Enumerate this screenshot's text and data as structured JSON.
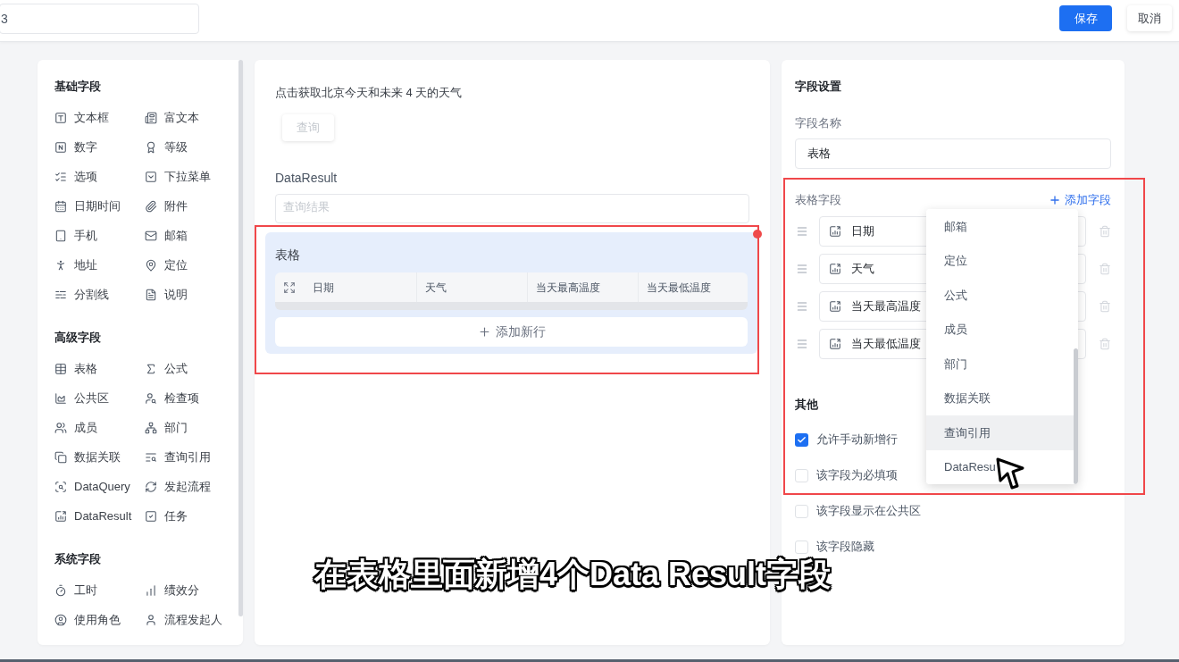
{
  "top_bar": {
    "name_field": {
      "value": "3"
    },
    "buttons": [
      {
        "label": "保存",
        "kind": "primary"
      },
      {
        "label": "取消",
        "kind": "secondary"
      }
    ]
  },
  "field_palette": {
    "sections": [
      {
        "title": "基础字段",
        "items": [
          "文本框",
          "富文本",
          "数字",
          "等级",
          "选项",
          "下拉菜单",
          "日期时间",
          "附件",
          "手机",
          "邮箱",
          "地址",
          "定位",
          "分割线",
          "说明"
        ]
      },
      {
        "title": "高级字段",
        "items": [
          "表格",
          "公式",
          "公共区",
          "检查项",
          "成员",
          "部门",
          "数据关联",
          "查询引用",
          "DataQuery",
          "发起流程",
          "DataResult",
          "任务"
        ]
      },
      {
        "title": "系统字段",
        "items": [
          "工时",
          "绩效分",
          "使用角色",
          "流程发起人"
        ]
      }
    ]
  },
  "form_canvas": {
    "description": "点击获取北京今天和未来 4 天的天气",
    "query_button": {
      "label": "查询",
      "disabled": true
    },
    "data_result_field": {
      "label": "DataResult",
      "placeholder": "查询结果"
    },
    "table_field": {
      "title": "表格",
      "selected": true,
      "columns": [
        "日期",
        "天气",
        "当天最高温度",
        "当天最低温度"
      ],
      "add_row_button": "添加新行"
    }
  },
  "settings_panel": {
    "title": "字段设置",
    "field_name": {
      "label": "字段名称",
      "value": "表格"
    },
    "table_fields": {
      "label": "表格字段",
      "add_link": "添加字段",
      "rows": [
        {
          "value": "日期"
        },
        {
          "value": "天气"
        },
        {
          "value": "当天最高温度"
        },
        {
          "value": "当天最低温度"
        }
      ]
    },
    "other": {
      "title": "其他",
      "options": [
        {
          "label": "允许手动新增行",
          "checked": true
        },
        {
          "label": "该字段为必填项",
          "checked": false
        },
        {
          "label": "该字段显示在公共区",
          "checked": false
        },
        {
          "label": "该字段隐藏",
          "checked": false
        }
      ]
    }
  },
  "field_type_dropdown": {
    "items": [
      {
        "label": "邮箱",
        "highlighted": false
      },
      {
        "label": "定位",
        "highlighted": false
      },
      {
        "label": "公式",
        "highlighted": false
      },
      {
        "label": "成员",
        "highlighted": false
      },
      {
        "label": "部门",
        "highlighted": false
      },
      {
        "label": "数据关联",
        "highlighted": false
      },
      {
        "label": "查询引用",
        "highlighted": true
      },
      {
        "label": "DataResu",
        "highlighted": false
      }
    ]
  },
  "subtitle": "在表格里面新增4个Data Result字段"
}
